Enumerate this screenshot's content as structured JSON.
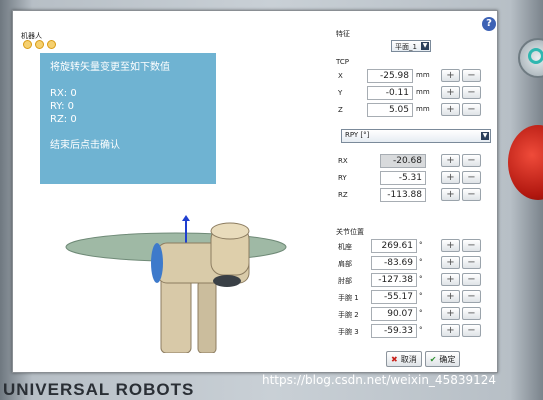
{
  "robot_panel": {
    "label": "机器人"
  },
  "info_box": {
    "line1": "将旋转矢量变更至如下数值",
    "rx": "RX: 0",
    "ry": "RY: 0",
    "rz": "RZ: 0",
    "footer": "结束后点击确认"
  },
  "feature": {
    "label": "特征",
    "selected": "平面_1"
  },
  "tcp": {
    "label": "TCP",
    "rows": [
      {
        "axis": "X",
        "value": "-25.98",
        "unit": "mm"
      },
      {
        "axis": "Y",
        "value": "-0.11",
        "unit": "mm"
      },
      {
        "axis": "Z",
        "value": "5.05",
        "unit": "mm"
      }
    ]
  },
  "rotation": {
    "mode": "RPY [°]",
    "rows": [
      {
        "axis": "RX",
        "value": "-20.68"
      },
      {
        "axis": "RY",
        "value": "-5.31"
      },
      {
        "axis": "RZ",
        "value": "-113.88"
      }
    ]
  },
  "joints": {
    "label": "关节位置",
    "rows": [
      {
        "name": "机座",
        "value": "269.61",
        "unit": "°"
      },
      {
        "name": "肩部",
        "value": "-83.69",
        "unit": "°"
      },
      {
        "name": "肘部",
        "value": "-127.38",
        "unit": "°"
      },
      {
        "name": "手腕 1",
        "value": "-55.17",
        "unit": "°"
      },
      {
        "name": "手腕 2",
        "value": "90.07",
        "unit": "°"
      },
      {
        "name": "手腕 3",
        "value": "-59.33",
        "unit": "°"
      }
    ]
  },
  "buttons": {
    "cancel": "取消",
    "ok": "确定",
    "plus": "+",
    "minus": "−"
  },
  "brand": "UNIVERSAL ROBOTS",
  "watermark": "https://blog.csdn.net/weixin_45839124",
  "help": "?",
  "colors": {
    "info_bg": "#6fb3d2",
    "estop": "#c8211a",
    "power_ring": "#2fb7b0"
  }
}
